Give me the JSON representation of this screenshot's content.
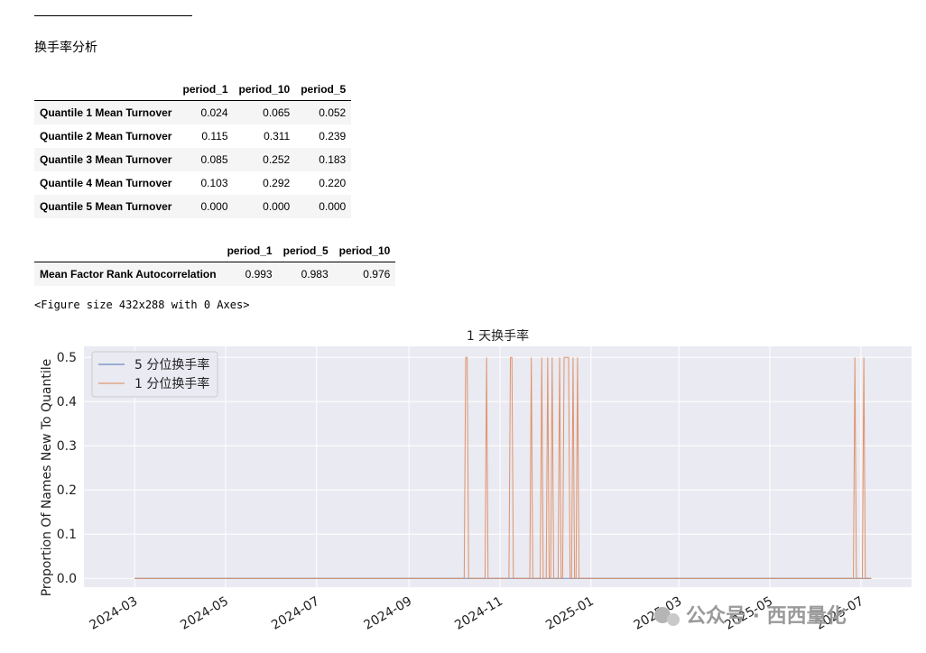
{
  "heading": "换手率分析",
  "table1": {
    "columns": [
      "period_1",
      "period_10",
      "period_5"
    ],
    "rows": [
      {
        "label": "Quantile 1 Mean Turnover",
        "values": [
          "0.024",
          "0.065",
          "0.052"
        ]
      },
      {
        "label": "Quantile 2 Mean Turnover",
        "values": [
          "0.115",
          "0.311",
          "0.239"
        ]
      },
      {
        "label": "Quantile 3 Mean Turnover",
        "values": [
          "0.085",
          "0.252",
          "0.183"
        ]
      },
      {
        "label": "Quantile 4 Mean Turnover",
        "values": [
          "0.103",
          "0.292",
          "0.220"
        ]
      },
      {
        "label": "Quantile 5 Mean Turnover",
        "values": [
          "0.000",
          "0.000",
          "0.000"
        ]
      }
    ]
  },
  "table2": {
    "columns": [
      "period_1",
      "period_5",
      "period_10"
    ],
    "rows": [
      {
        "label": "Mean Factor Rank Autocorrelation",
        "values": [
          "0.993",
          "0.983",
          "0.976"
        ]
      }
    ]
  },
  "figure_text": "<Figure size 432x288 with 0 Axes>",
  "watermark": {
    "text": "公众号 · 西西量化"
  },
  "chart_data": {
    "type": "line",
    "title": "1 天换手率",
    "xlabel": "",
    "ylabel": "Proportion Of Names New To Quantile",
    "xlim": [
      "2024-03-01",
      "2025-07-10"
    ],
    "ylim": [
      0,
      0.5
    ],
    "y_ticks": [
      "0.0",
      "0.1",
      "0.2",
      "0.3",
      "0.4",
      "0.5"
    ],
    "x_ticks": [
      "2024-03",
      "2024-05",
      "2024-07",
      "2024-09",
      "2024-11",
      "2025-01",
      "2025-03",
      "2025-05",
      "2025-07"
    ],
    "grid": true,
    "legend_position": "upper left",
    "background": "#eaeaf2",
    "series": [
      {
        "name": "5 分位换手率",
        "color": "#4c72b0",
        "points": [
          [
            "2024-03-01",
            0
          ],
          [
            "2025-07-08",
            0
          ]
        ]
      },
      {
        "name": "1 分位换手率",
        "color": "#dd8452",
        "points": [
          [
            "2024-03-01",
            0
          ],
          [
            "2024-10-08",
            0
          ],
          [
            "2024-10-09",
            0.5
          ],
          [
            "2024-10-10",
            0.5
          ],
          [
            "2024-10-11",
            0
          ],
          [
            "2024-10-22",
            0
          ],
          [
            "2024-10-23",
            0.5
          ],
          [
            "2024-10-24",
            0
          ],
          [
            "2024-11-07",
            0
          ],
          [
            "2024-11-08",
            0.5
          ],
          [
            "2024-11-09",
            0.5
          ],
          [
            "2024-11-10",
            0
          ],
          [
            "2024-11-21",
            0
          ],
          [
            "2024-11-22",
            0.5
          ],
          [
            "2024-11-23",
            0
          ],
          [
            "2024-11-28",
            0
          ],
          [
            "2024-11-29",
            0.5
          ],
          [
            "2024-11-30",
            0
          ],
          [
            "2024-12-02",
            0
          ],
          [
            "2024-12-03",
            0.5
          ],
          [
            "2024-12-04",
            0
          ],
          [
            "2024-12-05",
            0
          ],
          [
            "2024-12-06",
            0.5
          ],
          [
            "2024-12-07",
            0
          ],
          [
            "2024-12-10",
            0
          ],
          [
            "2024-12-11",
            0.5
          ],
          [
            "2024-12-12",
            0
          ],
          [
            "2024-12-13",
            0
          ],
          [
            "2024-12-14",
            0.5
          ],
          [
            "2024-12-17",
            0.5
          ],
          [
            "2024-12-18",
            0
          ],
          [
            "2024-12-19",
            0
          ],
          [
            "2024-12-20",
            0.5
          ],
          [
            "2024-12-21",
            0
          ],
          [
            "2024-12-22",
            0
          ],
          [
            "2024-12-23",
            0.5
          ],
          [
            "2024-12-24",
            0
          ],
          [
            "2025-06-26",
            0
          ],
          [
            "2025-06-27",
            0.5
          ],
          [
            "2025-06-28",
            0
          ],
          [
            "2025-07-02",
            0
          ],
          [
            "2025-07-03",
            0.5
          ],
          [
            "2025-07-04",
            0
          ],
          [
            "2025-07-08",
            0
          ]
        ]
      }
    ]
  }
}
